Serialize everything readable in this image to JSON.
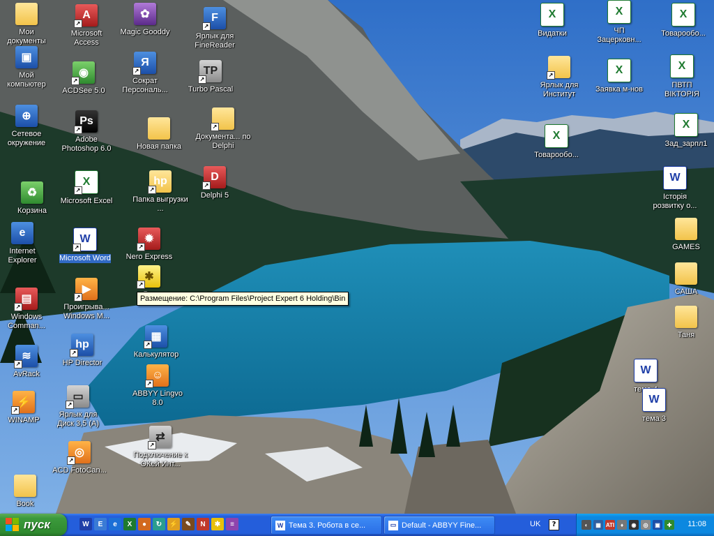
{
  "desktop": {
    "icons": [
      {
        "id": "my-documents",
        "label": "Мои документы",
        "glyph": "folder"
      },
      {
        "id": "my-computer",
        "label": "Мой компьютер",
        "glyph": "computer"
      },
      {
        "id": "network",
        "label": "Сетевое окружение",
        "glyph": "network"
      },
      {
        "id": "recycle-bin",
        "label": "Корзина",
        "glyph": "recycle-bin"
      },
      {
        "id": "internet-explorer",
        "label": "Internet Explorer",
        "glyph": "ie"
      },
      {
        "id": "windows-commander",
        "label": "Windows Comman...",
        "glyph": "floppy"
      },
      {
        "id": "avrack",
        "label": "AvRack",
        "glyph": "avrack"
      },
      {
        "id": "winamp",
        "label": "WINAMP",
        "glyph": "winamp"
      },
      {
        "id": "book",
        "label": "Book",
        "glyph": "folder"
      },
      {
        "id": "ms-access",
        "label": "Microsoft Access",
        "glyph": "access"
      },
      {
        "id": "acdsee",
        "label": "ACDSee 5.0",
        "glyph": "acdsee"
      },
      {
        "id": "photoshop",
        "label": "Adobe Photoshop 6.0",
        "glyph": "photoshop"
      },
      {
        "id": "ms-excel",
        "label": "Microsoft Excel",
        "glyph": "excel"
      },
      {
        "id": "ms-word",
        "label": "Microsoft Word",
        "glyph": "word"
      },
      {
        "id": "media-player",
        "label": "Проигрыва... Windows M...",
        "glyph": "media-player"
      },
      {
        "id": "hp-director",
        "label": "HP Director",
        "glyph": "hp"
      },
      {
        "id": "floppy-shortcut",
        "label": "Ярлык для Диск 3,5 (A)",
        "glyph": "floppy-drive"
      },
      {
        "id": "acd-foto",
        "label": "ACD FotoCan...",
        "glyph": "acd"
      },
      {
        "id": "magic-gooddy",
        "label": "Magic Gooddy",
        "glyph": "gooddy"
      },
      {
        "id": "sokrat",
        "label": "Сократ Персональ...",
        "glyph": "sokrat"
      },
      {
        "id": "new-folder",
        "label": "Новая папка",
        "glyph": "folder"
      },
      {
        "id": "hp-folder",
        "label": "Папка выгрузки ...",
        "glyph": "hp-folder"
      },
      {
        "id": "nero",
        "label": "Nero Express",
        "glyph": "nero"
      },
      {
        "id": "project-expert",
        "label": "Pro",
        "glyph": "bulb"
      },
      {
        "id": "calculator",
        "label": "Калькулятор",
        "glyph": "calculator"
      },
      {
        "id": "abbyy-lingvo",
        "label": "ABBYY Lingvo 8.0",
        "glyph": "lingvo"
      },
      {
        "id": "connection",
        "label": "Подключение к ОКей Инт...",
        "glyph": "connection"
      },
      {
        "id": "finereader",
        "label": "Ярлык для FineReader",
        "glyph": "finereader"
      },
      {
        "id": "turbo-pascal",
        "label": "Turbo Pascal",
        "glyph": "turbo-pascal"
      },
      {
        "id": "delphi-docs",
        "label": "Документа... по Delphi",
        "glyph": "folder"
      },
      {
        "id": "delphi5",
        "label": "Delphi 5",
        "glyph": "delphi"
      },
      {
        "id": "vydatky",
        "label": "Видатки",
        "glyph": "excel"
      },
      {
        "id": "institut",
        "label": "Ярлык для Институт",
        "glyph": "folder"
      },
      {
        "id": "tovaroob1",
        "label": "Товарообо...",
        "glyph": "excel"
      },
      {
        "id": "chp",
        "label": "ЧП Зацерковн...",
        "glyph": "excel"
      },
      {
        "id": "zayavka",
        "label": "Заявка м-нов",
        "glyph": "excel"
      },
      {
        "id": "tovaroob2",
        "label": "Товарообо...",
        "glyph": "excel"
      },
      {
        "id": "pvtp",
        "label": "ПВТП ВІКТОРІЯ",
        "glyph": "excel"
      },
      {
        "id": "zad-zarpl",
        "label": "Зад_зарпл1",
        "glyph": "excel"
      },
      {
        "id": "istoriya",
        "label": "Історія розвитку о...",
        "glyph": "word"
      },
      {
        "id": "games",
        "label": "GAMES",
        "glyph": "folder"
      },
      {
        "id": "sasha",
        "label": "САША",
        "glyph": "folder"
      },
      {
        "id": "tanya",
        "label": "Таня",
        "glyph": "folder"
      },
      {
        "id": "tema4",
        "label": "тема 4",
        "glyph": "word"
      },
      {
        "id": "tema3",
        "label": "тема 3",
        "glyph": "word"
      }
    ]
  },
  "tooltip": {
    "text": "Размещение: C:\\Program Files\\Project Expert 6 Holding\\Bin"
  },
  "taskbar": {
    "start_label": "пуск",
    "quick_launch": [
      {
        "icon": "word-icon",
        "glyph": "W",
        "color": "#1f3fa8"
      },
      {
        "icon": "windows-explorer-icon",
        "glyph": "E",
        "color": "#3a7bd5"
      },
      {
        "icon": "ie-icon",
        "glyph": "e",
        "color": "#1c6fd6"
      },
      {
        "icon": "excel-icon",
        "glyph": "X",
        "color": "#1e7a2f"
      },
      {
        "icon": "chrome-style-icon",
        "glyph": "●",
        "color": "#d2691e"
      },
      {
        "icon": "update-icon",
        "glyph": "↻",
        "color": "#2a9d8f"
      },
      {
        "icon": "winamp-icon",
        "glyph": "⚡",
        "color": "#e0a020"
      },
      {
        "icon": "tool-icon",
        "glyph": "✎",
        "color": "#7a4a1e"
      },
      {
        "icon": "nero-icon",
        "glyph": "N",
        "color": "#c0392b"
      },
      {
        "icon": "bulb-icon",
        "glyph": "✱",
        "color": "#e8c00b"
      },
      {
        "icon": "list-icon",
        "glyph": "≡",
        "color": "#8e44ad"
      }
    ],
    "buttons": [
      {
        "label": "Тема 3. Робота в се...",
        "icon": "W"
      },
      {
        "label": "Default - ABBYY Fine...",
        "icon": "▭"
      }
    ],
    "language": "UK",
    "help": "?",
    "tray_icons": [
      {
        "icon": "volume-icon",
        "glyph": "◐",
        "color": "#555"
      },
      {
        "icon": "network-icon",
        "glyph": "▦",
        "color": "#2f5fa0"
      },
      {
        "icon": "ati-icon",
        "glyph": "ATI",
        "color": "#c0392b"
      },
      {
        "icon": "antivirus-icon",
        "glyph": "♦",
        "color": "#777"
      },
      {
        "icon": "speaker-icon",
        "glyph": "◉",
        "color": "#333"
      },
      {
        "icon": "disc-icon",
        "glyph": "◎",
        "color": "#8a8a8a"
      },
      {
        "icon": "display-icon",
        "glyph": "▣",
        "color": "#1c4fa8"
      },
      {
        "icon": "shield-icon",
        "glyph": "✚",
        "color": "#2f8a2f"
      }
    ],
    "clock": "11:08"
  },
  "colors": {
    "taskbar": "#245edb",
    "start": "#3c9a3c",
    "tray": "#0c88e0",
    "tooltip_bg": "#ffffe1",
    "selection": "#316ac5"
  }
}
